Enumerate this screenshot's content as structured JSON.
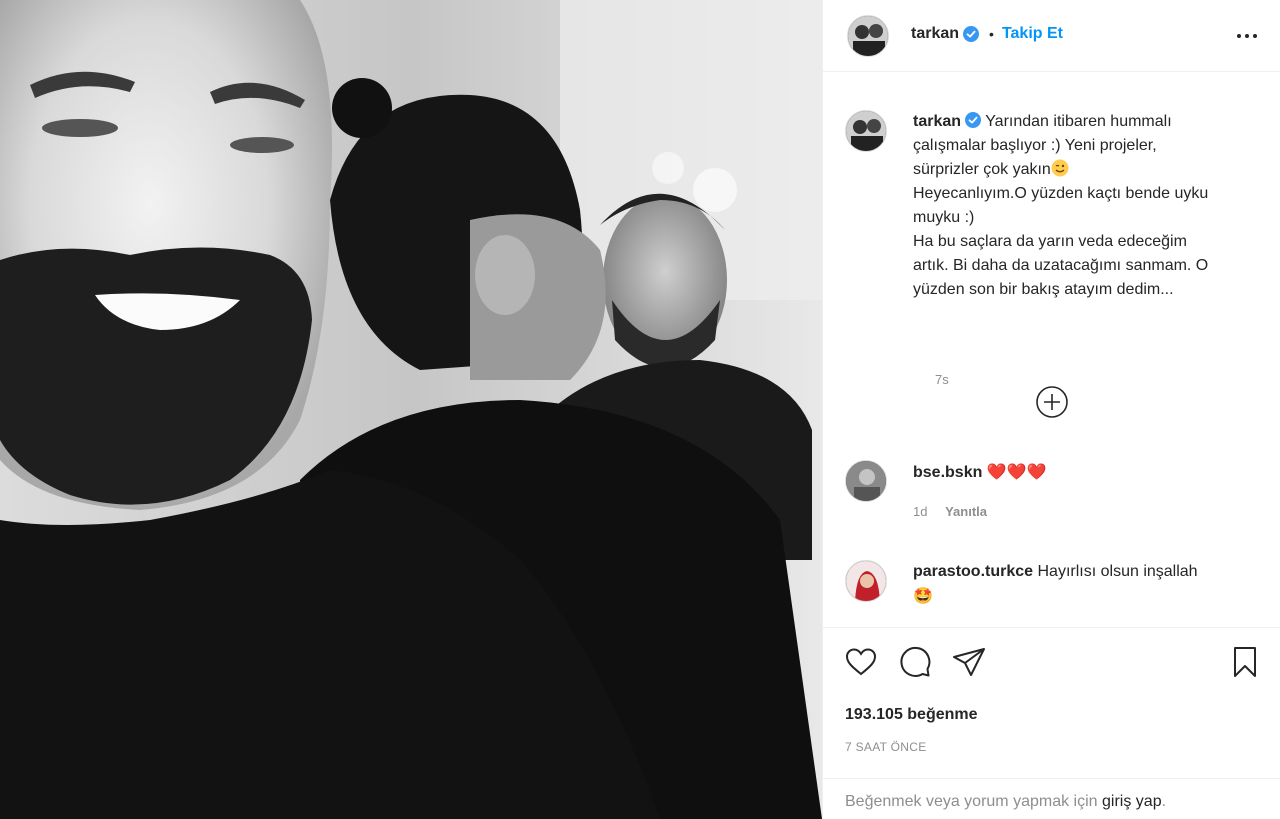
{
  "post": {
    "username": "tarkan",
    "follow_label": "Takip Et",
    "separator": "•",
    "caption_username": "tarkan",
    "caption_lines": [
      "Yarından itibaren hummalı",
      "çalışmalar başlıyor :) Yeni projeler,",
      "sürprizler çok yakın",
      "Heyecanlıyım.O yüzden kaçtı bende uyku",
      "muyku :)",
      "Ha bu saçlara da yarın veda edeceğim",
      "artık. Bi daha da uzatacağımı sanmam. O",
      "yüzden son bir bakış atayım dedim..."
    ],
    "caption_time": "7s"
  },
  "comments": [
    {
      "username": "bse.bskn",
      "text": "❤️❤️❤️",
      "time": "1d",
      "reply_label": "Yanıtla"
    },
    {
      "username": "parastoo.turkce",
      "text": "Hayırlısı olsun inşallah",
      "emoji_line": "🤩"
    }
  ],
  "actions": {
    "like_icon": "heart-icon",
    "comment_icon": "comment-icon",
    "share_icon": "share-icon",
    "save_icon": "bookmark-icon"
  },
  "likes_text": "193.105 beğenme",
  "posted_ago": "7 SAAT ÖNCE",
  "login_prompt": {
    "prefix": "Beğenmek veya yorum yapmak için",
    "link": "giriş yap",
    "suffix": "."
  },
  "colors": {
    "accent": "#0095f6",
    "text": "#262626",
    "muted": "#8e8e8e",
    "heart": "#ed4956"
  }
}
